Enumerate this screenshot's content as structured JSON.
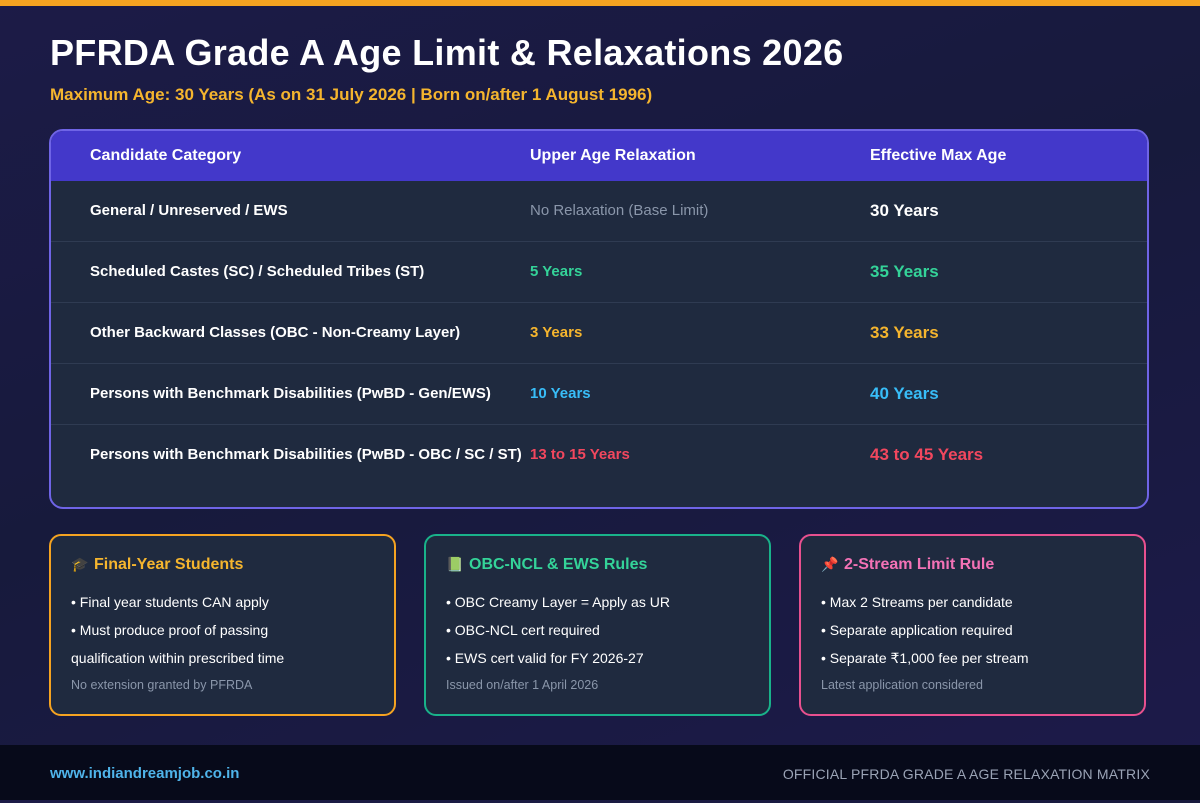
{
  "header": {
    "title": "PFRDA Grade A Age Limit & Relaxations 2026",
    "subtitle": "Maximum Age: 30 Years (As on 31 July 2026 | Born on/after 1 August 1996)"
  },
  "table": {
    "columns": [
      "Candidate Category",
      "Upper Age Relaxation",
      "Effective Max Age"
    ],
    "rows": [
      {
        "category": "General / Unreserved / EWS",
        "relaxation": "No Relaxation (Base Limit)",
        "max_age": "30 Years"
      },
      {
        "category": "Scheduled Castes (SC) / Scheduled Tribes (ST)",
        "relaxation": "5 Years",
        "max_age": "35 Years"
      },
      {
        "category": "Other Backward Classes (OBC - Non-Creamy Layer)",
        "relaxation": "3 Years",
        "max_age": "33 Years"
      },
      {
        "category": "Persons with Benchmark Disabilities (PwBD - Gen/EWS)",
        "relaxation": "10 Years",
        "max_age": "40 Years"
      },
      {
        "category": "Persons with Benchmark Disabilities (PwBD - OBC / SC / ST)",
        "relaxation": "13 to 15 Years",
        "max_age": "43 to 45 Years"
      }
    ]
  },
  "cards": [
    {
      "icon": "graduation-cap-icon",
      "title": "Final-Year Students",
      "lines": [
        "• Final year students CAN apply",
        "• Must produce proof of passing",
        "qualification within prescribed time"
      ],
      "note": "No extension granted by PFRDA"
    },
    {
      "icon": "book-icon",
      "title": "OBC-NCL & EWS Rules",
      "lines": [
        "• OBC Creamy Layer = Apply as UR",
        "• OBC-NCL cert required",
        "• EWS cert valid for FY 2026-27"
      ],
      "note": "Issued on/after 1 April 2026"
    },
    {
      "icon": "pushpin-icon",
      "title": "2-Stream Limit Rule",
      "lines": [
        "• Max 2 Streams per candidate",
        "• Separate application required",
        "• Separate ₹1,000 fee per stream"
      ],
      "note": "Latest application considered"
    }
  ],
  "footer": {
    "url": "www.indiandreamjob.co.in",
    "tagline": "OFFICIAL PFRDA GRADE A AGE RELAXATION MATRIX"
  },
  "colors": {
    "accent_orange": "#f5a321",
    "header_purple": "#4338ca",
    "green": "#34d399",
    "amber": "#f5b52e",
    "blue": "#38bdf8",
    "red": "#f2475e",
    "pink": "#e8508f"
  }
}
